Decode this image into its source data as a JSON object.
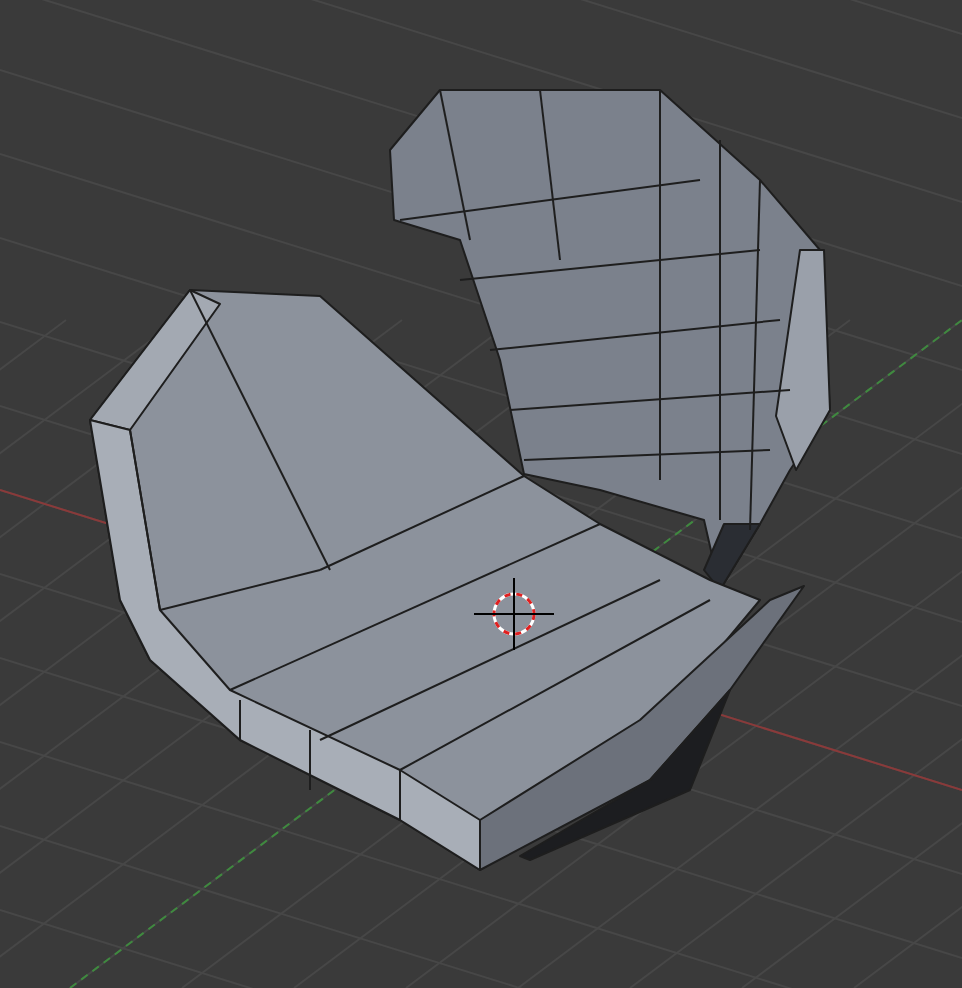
{
  "viewport": {
    "grid_visible": true,
    "cursor_visible": true
  }
}
